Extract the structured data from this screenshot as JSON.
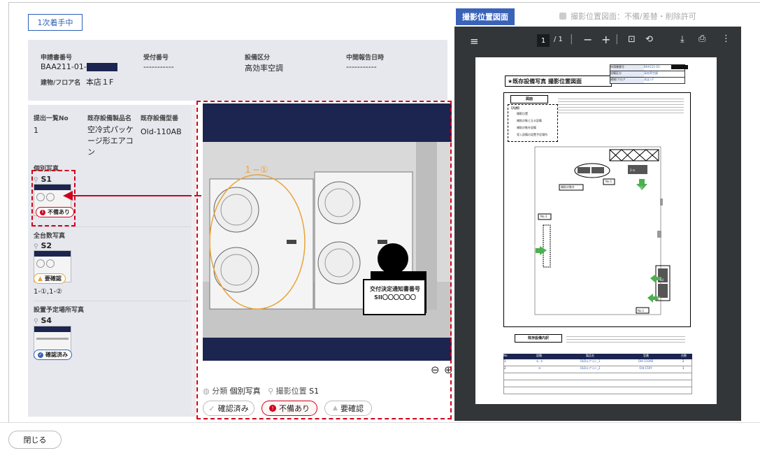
{
  "status_tag": "1次着手中",
  "info": {
    "app_no_label": "申請書番号",
    "app_no_value": "BAA211-01-",
    "receipt_label": "受付番号",
    "receipt_value": "-----------",
    "equipment_label": "設備区分",
    "equipment_value": "高効率空調",
    "interim_label": "中間報告日時",
    "interim_value": "-----------",
    "building_label": "建物/フロア名",
    "building_value": "本店１F"
  },
  "list": {
    "col1_label": "提出一覧No",
    "col1_value": "1",
    "col2_label": "既存設備製品名",
    "col2_value": "空冷式パッケージ形エアコン",
    "col3_label": "既存設備型番",
    "col3_value": "Old-110AB",
    "sections": [
      {
        "title": "個別写真",
        "pin": "S1",
        "badge": "不備あり"
      },
      {
        "title": "全台数写真",
        "pin": "S2",
        "badge": "要確認",
        "note": "1-①,1-②"
      },
      {
        "title": "設置予定場所写真",
        "pin": "S4",
        "badge": "確認済み"
      }
    ]
  },
  "photo": {
    "overlay_label": "１−①",
    "sign_line1": "交付決定通知書番号",
    "sign_line2": "SII〇〇〇〇〇〇",
    "category_label": "分類",
    "category_value": "個別写真",
    "position_label": "撮影位置",
    "position_value": "S1",
    "btn_confirmed": "確認済み",
    "btn_defect": "不備あり",
    "btn_review": "要確認"
  },
  "viewer": {
    "tab_active": "撮影位置図面",
    "tab_inactive": "撮影位置図面：不備/差替・削除許可",
    "page_current": "1",
    "page_total": "/ 1",
    "doc_title": "★既存設備写真 撮影位置図面",
    "meta_rows": [
      {
        "k": "申請書番号",
        "v": "BAA211-01-"
      },
      {
        "k": "設備区分",
        "v": "高効率空調"
      },
      {
        "k": "建物/フロア",
        "v": "本店１F"
      }
    ],
    "section1": "図面",
    "legend_title": "【凡例】",
    "legend_items": [
      "撮影位置",
      "補助対象となる設備",
      "補助対象外設備",
      "導入設備の設置予定場所"
    ],
    "section2": "既存設備内訳",
    "table_headers": [
      "No.",
      "設備",
      "製品名",
      "型番",
      "台数"
    ],
    "table_rows": [
      [
        "1",
        "①, ②",
        "OLDエアコン_1",
        "Old-110AB",
        "2"
      ],
      [
        "2",
        "③",
        "OLDエアコン_2",
        "Old-150Y",
        "1"
      ]
    ],
    "map_labels": [
      "2-①",
      "No.1",
      "S2",
      "No.3",
      "S4",
      "S3",
      "S1",
      "No.1",
      "補助対象外"
    ]
  },
  "footer": {
    "close_label": "閉じる"
  },
  "colors": {
    "accent": "#3a63b8",
    "navy": "#1b2550",
    "red": "#d0021b",
    "orange": "#e8a33a"
  }
}
